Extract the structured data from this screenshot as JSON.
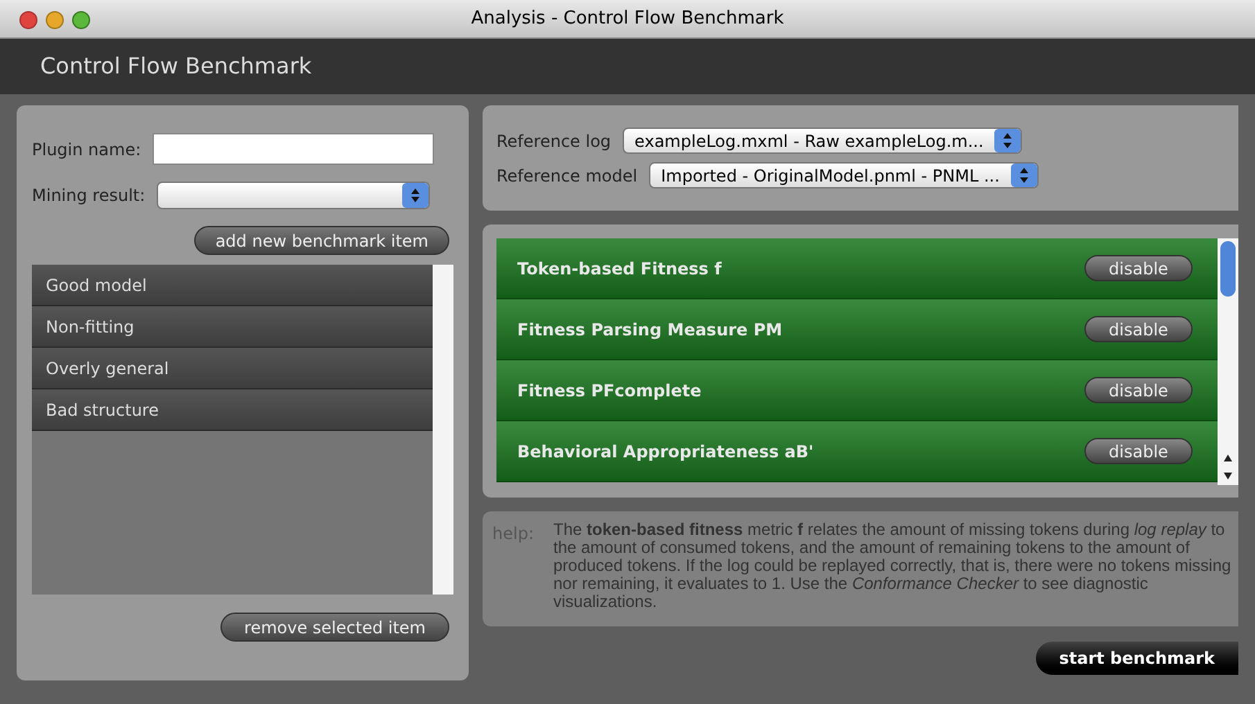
{
  "window": {
    "title": "Analysis - Control Flow Benchmark"
  },
  "header": {
    "title": "Control Flow Benchmark"
  },
  "left_panel": {
    "plugin_name": {
      "label": "Plugin name:"
    },
    "mining_result": {
      "label": "Mining result:"
    },
    "add_button": "add new benchmark item",
    "items": [
      {
        "label": "Good model"
      },
      {
        "label": "Non-fitting"
      },
      {
        "label": "Overly general"
      },
      {
        "label": "Bad structure"
      }
    ],
    "remove_button": "remove selected item"
  },
  "reference": {
    "log": {
      "label": "Reference log",
      "value": "exampleLog.mxml - Raw exampleLog.m..."
    },
    "model": {
      "label": "Reference model",
      "value": "Imported - OriginalModel.pnml - PNML ..."
    }
  },
  "metrics": [
    {
      "label": "Token-based Fitness f",
      "button": "disable"
    },
    {
      "label": "Fitness Parsing Measure PM",
      "button": "disable"
    },
    {
      "label": "Fitness PFcomplete",
      "button": "disable"
    },
    {
      "label": "Behavioral Appropriateness aB'",
      "button": "disable"
    }
  ],
  "help": {
    "label": "help:",
    "text": "The **token-based fitness** metric **f** relates the amount of missing tokens during *log replay* to the amount of consumed tokens, and the amount of remaining tokens to the amount of produced tokens. If the log could be replayed correctly, that is, there were no tokens missing nor remaining, it evaluates to 1. Use the *Conformance Checker* to see diagnostic visualizations."
  },
  "start_button": "start benchmark"
}
